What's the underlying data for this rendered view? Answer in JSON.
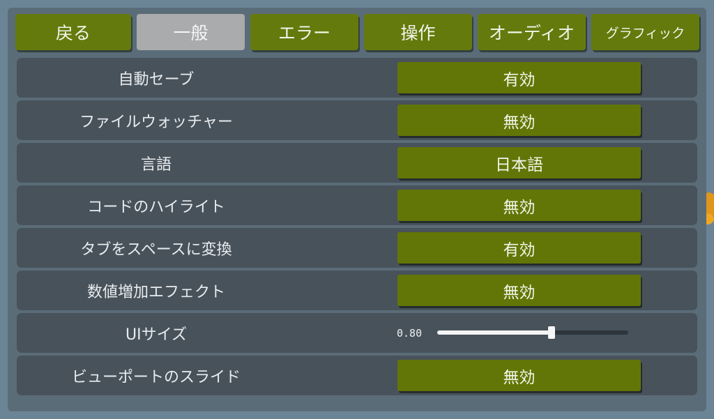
{
  "tabs": [
    {
      "label": "戻る",
      "active": false
    },
    {
      "label": "一般",
      "active": true
    },
    {
      "label": "エラー",
      "active": false
    },
    {
      "label": "操作",
      "active": false
    },
    {
      "label": "オーディオ",
      "active": false
    },
    {
      "label": "グラフィック",
      "active": false
    }
  ],
  "settings": {
    "autosave": {
      "label": "自動セーブ",
      "value": "有効"
    },
    "file_watcher": {
      "label": "ファイルウォッチャー",
      "value": "無効"
    },
    "language": {
      "label": "言語",
      "value": "日本語"
    },
    "code_highlight": {
      "label": "コードのハイライト",
      "value": "無効"
    },
    "tabs_to_spaces": {
      "label": "タブをスペースに変換",
      "value": "有効"
    },
    "number_increase_effect": {
      "label": "数値増加エフェクト",
      "value": "無効"
    },
    "ui_size": {
      "label": "UIサイズ",
      "value": "0.80",
      "slider_fraction": 0.6
    },
    "viewport_slide": {
      "label": "ビューポートのスライド",
      "value": "無効"
    }
  },
  "colors": {
    "background": "#6c8596",
    "panel": "#5a6c78",
    "row": "#48525b",
    "accent_green": "#627607",
    "active_tab": "#a9abad"
  }
}
